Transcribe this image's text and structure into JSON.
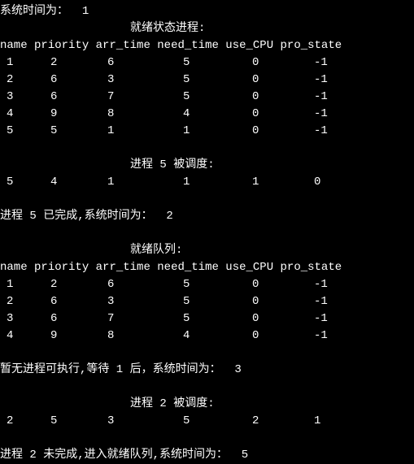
{
  "sys_time_label": "系统时间为：",
  "sys_time_1": "1",
  "ready_title": "就绪状态进程:",
  "headers": {
    "name": "name",
    "priority": "priority",
    "arr_time": "arr_time",
    "need_time": "need_time",
    "use_cpu": "use_CPU",
    "pro_state": "pro_state"
  },
  "ready_rows_1": [
    {
      "name": "1",
      "priority": "2",
      "arr_time": "6",
      "need_time": "5",
      "use_cpu": "0",
      "pro_state": "-1"
    },
    {
      "name": "2",
      "priority": "6",
      "arr_time": "3",
      "need_time": "5",
      "use_cpu": "0",
      "pro_state": "-1"
    },
    {
      "name": "3",
      "priority": "6",
      "arr_time": "7",
      "need_time": "5",
      "use_cpu": "0",
      "pro_state": "-1"
    },
    {
      "name": "4",
      "priority": "9",
      "arr_time": "8",
      "need_time": "4",
      "use_cpu": "0",
      "pro_state": "-1"
    },
    {
      "name": "5",
      "priority": "5",
      "arr_time": "1",
      "need_time": "1",
      "use_cpu": "0",
      "pro_state": "-1"
    }
  ],
  "scheduled_5_title": "进程 5 被调度:",
  "scheduled_5_row": {
    "name": "5",
    "priority": "4",
    "arr_time": "1",
    "need_time": "1",
    "use_cpu": "1",
    "pro_state": "0"
  },
  "done_5_msg": "进程 5 已完成,系统时间为：  2",
  "ready_queue_title": "就绪队列:",
  "ready_rows_2": [
    {
      "name": "1",
      "priority": "2",
      "arr_time": "6",
      "need_time": "5",
      "use_cpu": "0",
      "pro_state": "-1"
    },
    {
      "name": "2",
      "priority": "6",
      "arr_time": "3",
      "need_time": "5",
      "use_cpu": "0",
      "pro_state": "-1"
    },
    {
      "name": "3",
      "priority": "6",
      "arr_time": "7",
      "need_time": "5",
      "use_cpu": "0",
      "pro_state": "-1"
    },
    {
      "name": "4",
      "priority": "9",
      "arr_time": "8",
      "need_time": "4",
      "use_cpu": "0",
      "pro_state": "-1"
    }
  ],
  "wait_msg": "暂无进程可执行,等待 1 后，系统时间为：  3",
  "scheduled_2_title": "进程 2 被调度:",
  "scheduled_2_row": {
    "name": "2",
    "priority": "5",
    "arr_time": "3",
    "need_time": "5",
    "use_cpu": "2",
    "pro_state": "1"
  },
  "not_done_2_msg": "进程 2 未完成,进入就绪队列,系统时间为：  5"
}
